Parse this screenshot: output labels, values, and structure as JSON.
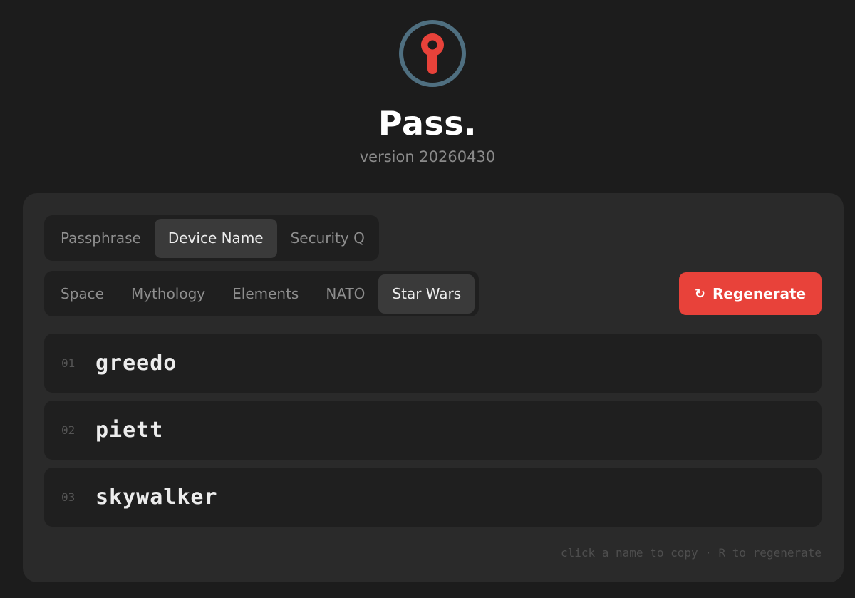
{
  "app": {
    "title": "Pass.",
    "version": "version 20260430"
  },
  "colors": {
    "accent": "#e8423a",
    "logo_ring": "#4f6f80",
    "background": "#1c1c1c",
    "card": "#2a2a2a"
  },
  "icons": {
    "logo": "keyhole-icon",
    "regenerate": "refresh-icon"
  },
  "mode_tabs": [
    {
      "label": "Passphrase",
      "active": false
    },
    {
      "label": "Device Name",
      "active": true
    },
    {
      "label": "Security Q",
      "active": false
    }
  ],
  "theme_tabs": [
    {
      "label": "Space",
      "active": false
    },
    {
      "label": "Mythology",
      "active": false
    },
    {
      "label": "Elements",
      "active": false
    },
    {
      "label": "NATO",
      "active": false
    },
    {
      "label": "Star Wars",
      "active": true
    }
  ],
  "regenerate": {
    "icon": "↻",
    "label": "Regenerate"
  },
  "names": [
    {
      "num": "01",
      "name": "greedo"
    },
    {
      "num": "02",
      "name": "piett"
    },
    {
      "num": "03",
      "name": "skywalker"
    }
  ],
  "hint": "click a name to copy · R to regenerate"
}
